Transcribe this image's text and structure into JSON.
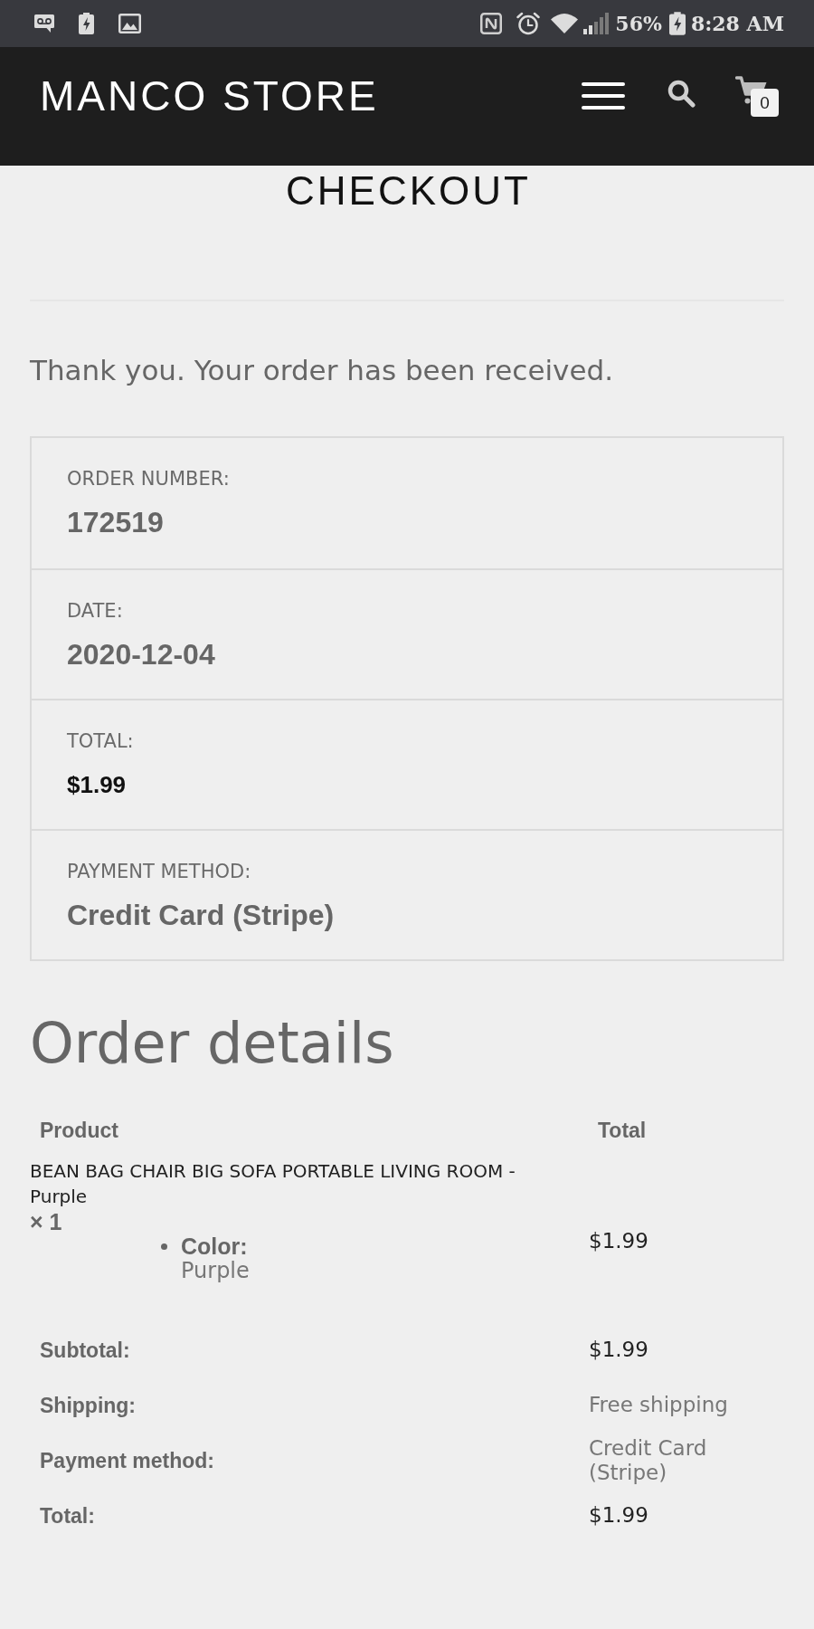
{
  "status_bar": {
    "battery": "56%",
    "time": "8:28 AM"
  },
  "header": {
    "logo": "MANCO STORE",
    "cart_count": "0"
  },
  "page_title": "CHECKOUT",
  "notice": "Thank you. Your order has been received.",
  "overview": [
    {
      "label": "ORDER NUMBER:",
      "value": "172519",
      "kind": "text"
    },
    {
      "label": "DATE:",
      "value": "2020-12-04",
      "kind": "text"
    },
    {
      "label": "TOTAL:",
      "value": "$1.99",
      "kind": "amount"
    },
    {
      "label": "PAYMENT METHOD:",
      "value": "Credit Card (Stripe)",
      "kind": "text"
    }
  ],
  "order_details": {
    "title": "Order details",
    "columns": [
      "Product",
      "Total"
    ],
    "items": [
      {
        "name": "BEAN BAG CHAIR BIG SOFA PORTABLE LIVING ROOM - Purple",
        "quantity": "× 1",
        "meta": [
          {
            "label": "Color:",
            "value": "Purple"
          }
        ],
        "total": "$1.99"
      }
    ],
    "totals": [
      {
        "label": "Subtotal:",
        "value": "$1.99",
        "kind": "amount"
      },
      {
        "label": "Shipping:",
        "value": "Free shipping",
        "kind": "note"
      },
      {
        "label": "Payment method:",
        "value": "Credit Card (Stripe)",
        "kind": "note"
      },
      {
        "label": "Total:",
        "value": "$1.99",
        "kind": "amount"
      }
    ]
  }
}
